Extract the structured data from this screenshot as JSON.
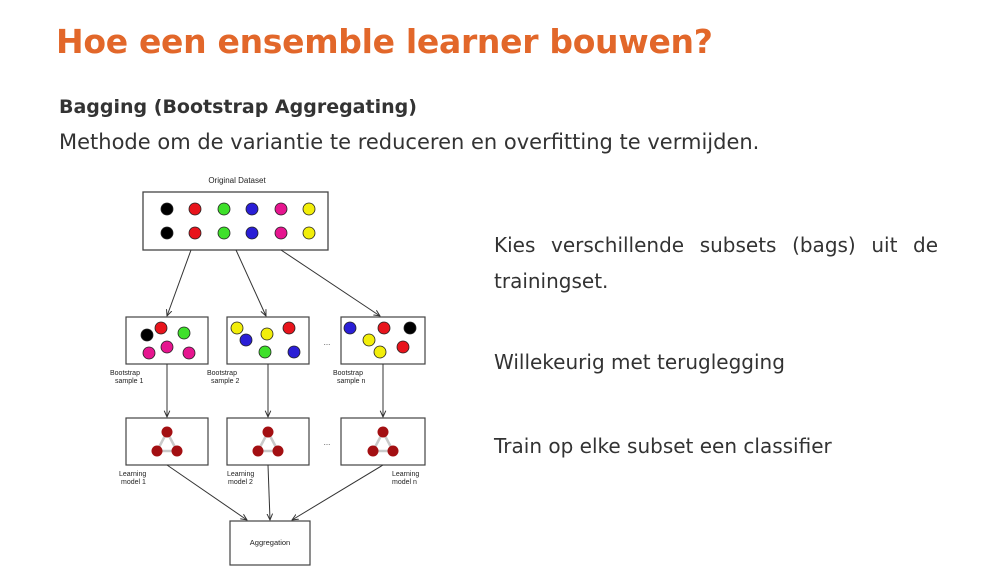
{
  "slide": {
    "title": "Hoe een ensemble learner bouwen?",
    "subtitle": "Bagging (Bootstrap Aggregating)",
    "intro": "Methode om de variantie te reduceren en overfitting te vermijden."
  },
  "diagram": {
    "original_label": "Original Dataset",
    "bootstrap_labels": [
      {
        "line1": "Bootstrap",
        "line2": "sample 1"
      },
      {
        "line1": "Bootstrap",
        "line2": "sample 2"
      },
      {
        "line1": "Bootstrap",
        "line2": "sample n"
      }
    ],
    "model_labels": [
      {
        "line1": "Learning",
        "line2": "model 1"
      },
      {
        "line1": "Learning",
        "line2": "model 2"
      },
      {
        "line1": "Learning",
        "line2": "model n"
      }
    ],
    "ellipsis": "...",
    "aggregation_label": "Aggregation",
    "colors": {
      "black": "#000000",
      "red": "#e8141c",
      "green": "#3ee02a",
      "blue": "#2a1ed6",
      "magenta": "#e6158f",
      "yellow": "#f2ee0a",
      "node": "#a30f12",
      "edge": "#c9c9c9"
    },
    "original_rows": [
      [
        "black",
        "red",
        "green",
        "blue",
        "magenta",
        "yellow"
      ],
      [
        "black",
        "red",
        "green",
        "blue",
        "magenta",
        "yellow"
      ]
    ],
    "samples": [
      [
        "black",
        "red",
        "green",
        "magenta",
        "magenta",
        "magenta"
      ],
      [
        "yellow",
        "yellow",
        "red",
        "blue",
        "green",
        "blue"
      ],
      [
        "blue",
        "red",
        "black",
        "yellow",
        "yellow",
        "red"
      ]
    ]
  },
  "bullets": [
    "Kies verschillende subsets (bags) uit de trainingset.",
    "Willekeurig met teruglegging",
    "Train op elke subset een classifier"
  ]
}
